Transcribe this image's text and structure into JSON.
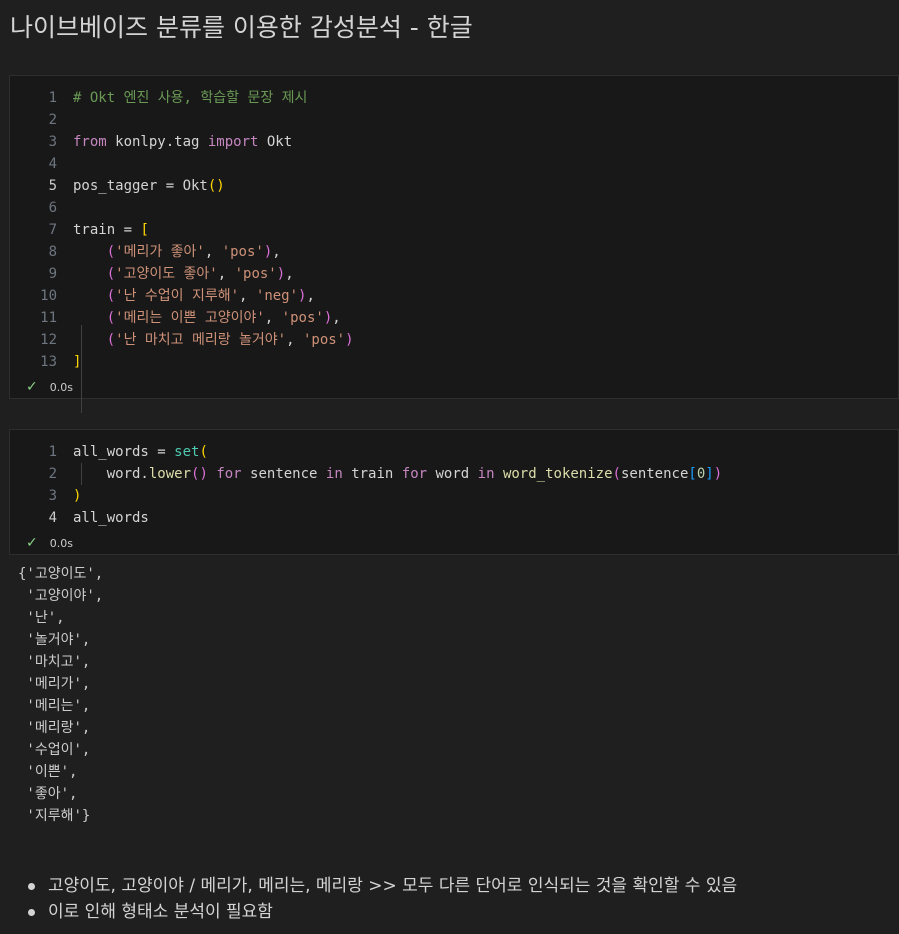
{
  "heading": "나이브베이즈 분류를 이용한 감성분석 - 한글",
  "cell1": {
    "status": "0.0s",
    "lines": [
      {
        "n": "1",
        "parts": [
          {
            "t": "# Okt 엔진 사용, 학습할 문장 제시",
            "c": "t-comment"
          }
        ]
      },
      {
        "n": "2",
        "parts": []
      },
      {
        "n": "3",
        "parts": [
          {
            "t": "from",
            "c": "t-kw"
          },
          {
            "t": " konlpy.tag ",
            "c": "t-var"
          },
          {
            "t": "import",
            "c": "t-kw"
          },
          {
            "t": " Okt",
            "c": "t-var"
          }
        ]
      },
      {
        "n": "4",
        "parts": []
      },
      {
        "n": "5",
        "active": true,
        "parts": [
          {
            "t": "pos_tagger = Okt",
            "c": "t-var"
          },
          {
            "t": "()",
            "c": "t-br1"
          }
        ]
      },
      {
        "n": "6",
        "parts": []
      },
      {
        "n": "7",
        "parts": [
          {
            "t": "train = ",
            "c": "t-var"
          },
          {
            "t": "[",
            "c": "t-br1"
          }
        ]
      },
      {
        "n": "8",
        "parts": [
          {
            "t": "    ",
            "c": "t-var"
          },
          {
            "t": "(",
            "c": "t-br2"
          },
          {
            "t": "'메리가 좋아'",
            "c": "t-str"
          },
          {
            "t": ", ",
            "c": "t-var"
          },
          {
            "t": "'pos'",
            "c": "t-str"
          },
          {
            "t": ")",
            "c": "t-br2"
          },
          {
            "t": ",",
            "c": "t-var"
          }
        ]
      },
      {
        "n": "9",
        "parts": [
          {
            "t": "    ",
            "c": "t-var"
          },
          {
            "t": "(",
            "c": "t-br2"
          },
          {
            "t": "'고양이도 좋아'",
            "c": "t-str"
          },
          {
            "t": ", ",
            "c": "t-var"
          },
          {
            "t": "'pos'",
            "c": "t-str"
          },
          {
            "t": ")",
            "c": "t-br2"
          },
          {
            "t": ",",
            "c": "t-var"
          }
        ]
      },
      {
        "n": "10",
        "parts": [
          {
            "t": "    ",
            "c": "t-var"
          },
          {
            "t": "(",
            "c": "t-br2"
          },
          {
            "t": "'난 수업이 지루해'",
            "c": "t-str"
          },
          {
            "t": ", ",
            "c": "t-var"
          },
          {
            "t": "'neg'",
            "c": "t-str"
          },
          {
            "t": ")",
            "c": "t-br2"
          },
          {
            "t": ",",
            "c": "t-var"
          }
        ]
      },
      {
        "n": "11",
        "parts": [
          {
            "t": "    ",
            "c": "t-var"
          },
          {
            "t": "(",
            "c": "t-br2"
          },
          {
            "t": "'메리는 이쁜 고양이야'",
            "c": "t-str"
          },
          {
            "t": ", ",
            "c": "t-var"
          },
          {
            "t": "'pos'",
            "c": "t-str"
          },
          {
            "t": ")",
            "c": "t-br2"
          },
          {
            "t": ",",
            "c": "t-var"
          }
        ]
      },
      {
        "n": "12",
        "parts": [
          {
            "t": "    ",
            "c": "t-var"
          },
          {
            "t": "(",
            "c": "t-br2"
          },
          {
            "t": "'난 마치고 메리랑 놀거야'",
            "c": "t-str"
          },
          {
            "t": ", ",
            "c": "t-var"
          },
          {
            "t": "'pos'",
            "c": "t-str"
          },
          {
            "t": ")",
            "c": "t-br2"
          }
        ]
      },
      {
        "n": "13",
        "parts": [
          {
            "t": "]",
            "c": "t-br1"
          }
        ]
      }
    ]
  },
  "cell2": {
    "status": "0.0s",
    "lines": [
      {
        "n": "1",
        "parts": [
          {
            "t": "all_words = ",
            "c": "t-var"
          },
          {
            "t": "set",
            "c": "t-type"
          },
          {
            "t": "(",
            "c": "t-br1"
          }
        ]
      },
      {
        "n": "2",
        "parts": [
          {
            "t": "    word.",
            "c": "t-var"
          },
          {
            "t": "lower",
            "c": "t-fn"
          },
          {
            "t": "()",
            "c": "t-br2"
          },
          {
            "t": " ",
            "c": "t-var"
          },
          {
            "t": "for",
            "c": "t-kw"
          },
          {
            "t": " sentence ",
            "c": "t-var"
          },
          {
            "t": "in",
            "c": "t-kw"
          },
          {
            "t": " train ",
            "c": "t-var"
          },
          {
            "t": "for",
            "c": "t-kw"
          },
          {
            "t": " word ",
            "c": "t-var"
          },
          {
            "t": "in",
            "c": "t-kw"
          },
          {
            "t": " ",
            "c": "t-var"
          },
          {
            "t": "word_tokenize",
            "c": "t-fn"
          },
          {
            "t": "(",
            "c": "t-br2"
          },
          {
            "t": "sentence",
            "c": "t-var"
          },
          {
            "t": "[",
            "c": "t-br3"
          },
          {
            "t": "0",
            "c": "t-num"
          },
          {
            "t": "]",
            "c": "t-br3"
          },
          {
            "t": ")",
            "c": "t-br2"
          }
        ]
      },
      {
        "n": "3",
        "parts": [
          {
            "t": ")",
            "c": "t-br1"
          }
        ]
      },
      {
        "n": "4",
        "active": true,
        "parts": [
          {
            "t": "all_words",
            "c": "t-var"
          }
        ]
      }
    ]
  },
  "output": [
    "{'고양이도',",
    " '고양이야',",
    " '난',",
    " '놀거야',",
    " '마치고',",
    " '메리가',",
    " '메리는',",
    " '메리랑',",
    " '수업이',",
    " '이쁜',",
    " '좋아',",
    " '지루해'}"
  ],
  "notes": [
    "고양이도, 고양이야 / 메리가, 메리는, 메리랑 >> 모두 다른 단어로 인식되는 것을 확인할 수 있음",
    "이로 인해 형태소 분석이 필요함"
  ]
}
